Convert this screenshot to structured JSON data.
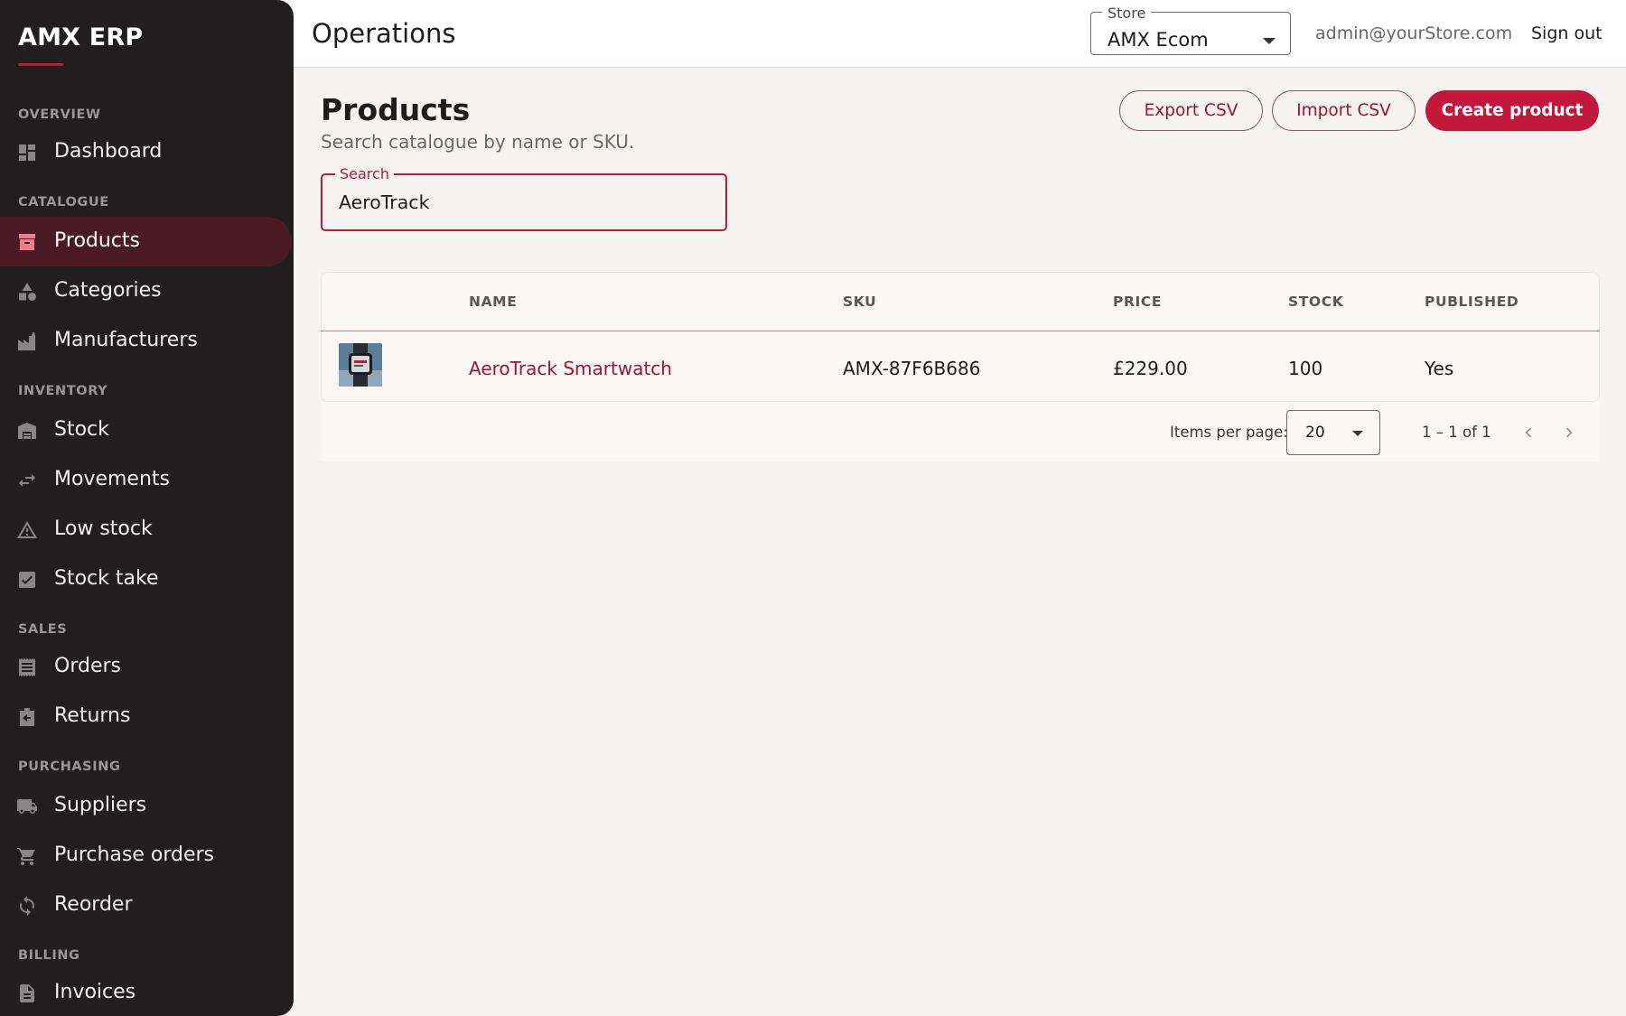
{
  "sidebar": {
    "brand": "AMX ERP",
    "sections": {
      "overview": "OVERVIEW",
      "catalogue": "CATALOGUE",
      "inventory": "INVENTORY",
      "sales": "SALES",
      "purchasing": "PURCHASING",
      "billing": "BILLING"
    },
    "items": {
      "dashboard": {
        "label": "Dashboard",
        "icon": "dashboard-icon"
      },
      "products": {
        "label": "Products",
        "icon": "archive-icon",
        "active": true
      },
      "categories": {
        "label": "Categories",
        "icon": "category-shapes-icon"
      },
      "manufacturers": {
        "label": "Manufacturers",
        "icon": "factory-icon"
      },
      "stock": {
        "label": "Stock",
        "icon": "warehouse-icon"
      },
      "movements": {
        "label": "Movements",
        "icon": "swap-arrows-icon"
      },
      "low_stock": {
        "label": "Low stock",
        "icon": "warning-icon"
      },
      "stock_take": {
        "label": "Stock take",
        "icon": "checklist-icon"
      },
      "orders": {
        "label": "Orders",
        "icon": "receipt-icon"
      },
      "returns": {
        "label": "Returns",
        "icon": "return-box-icon"
      },
      "suppliers": {
        "label": "Suppliers",
        "icon": "truck-icon"
      },
      "purchase_orders": {
        "label": "Purchase orders",
        "icon": "cart-icon"
      },
      "reorder": {
        "label": "Reorder",
        "icon": "refresh-icon"
      },
      "invoices": {
        "label": "Invoices",
        "icon": "document-icon"
      }
    }
  },
  "topbar": {
    "title": "Operations",
    "store_label": "Store",
    "store_value": "AMX Ecom",
    "user_email": "admin@yourStore.com",
    "signout": "Sign out"
  },
  "main": {
    "title": "Products",
    "subtitle": "Search catalogue by name or SKU.",
    "buttons": {
      "export": "Export CSV",
      "import": "Import CSV",
      "create": "Create product"
    },
    "search": {
      "label": "Search",
      "value": "AeroTrack"
    },
    "table": {
      "columns": {
        "name": "NAME",
        "sku": "SKU",
        "price": "PRICE",
        "stock": "STOCK",
        "published": "PUBLISHED"
      },
      "rows": [
        {
          "thumbnail": "smartwatch-thumbnail",
          "name": "AeroTrack Smartwatch",
          "sku": "AMX-87F6B686",
          "price": "£229.00",
          "stock": "100",
          "published": "Yes"
        }
      ]
    },
    "paginator": {
      "label": "Items per page:",
      "page_size": "20",
      "range": "1 – 1 of 1"
    }
  },
  "colors": {
    "accent": "#c2183b",
    "sidebar_bg": "#201e1f",
    "active_item_bg": "#4a1a24",
    "page_bg": "#f6f4f3"
  }
}
